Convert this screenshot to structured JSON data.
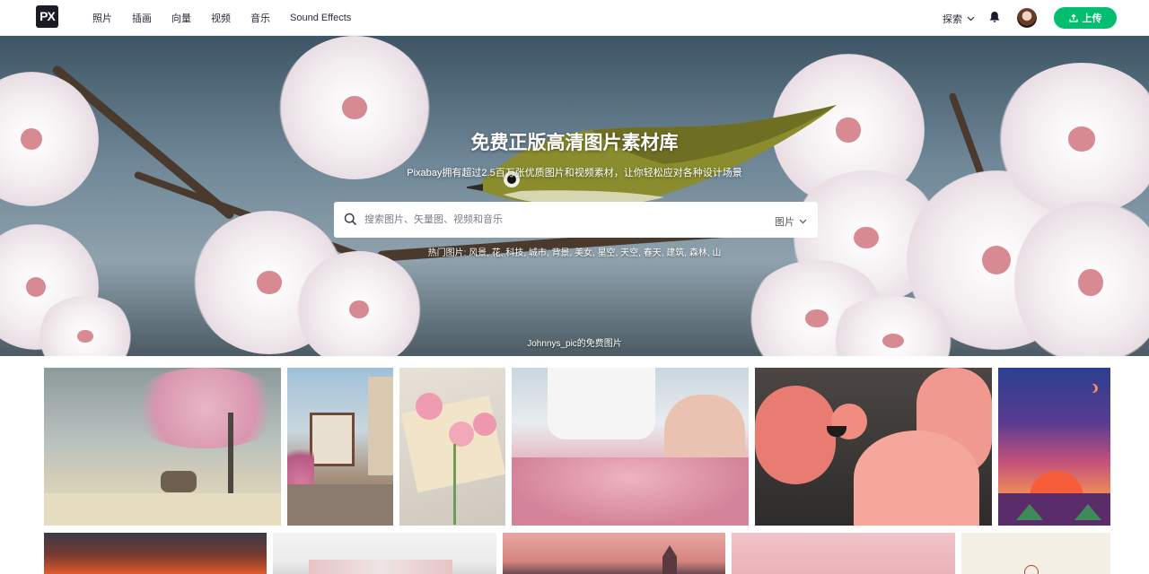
{
  "header": {
    "logo_text": "PX",
    "nav": [
      "照片",
      "插画",
      "向量",
      "视频",
      "音乐",
      "Sound Effects"
    ],
    "explore_label": "探索",
    "upload_label": "上传",
    "accent_color": "#02be6e"
  },
  "hero": {
    "title": "免费正版高清图片素材库",
    "subtitle": "Pixabay拥有超过2.5百万张优质图片和视频素材，让你轻松应对各种设计场景",
    "search": {
      "placeholder": "搜索图片、矢量图、视频和音乐",
      "type_label": "图片"
    },
    "popular_label": "热门图片:",
    "popular_tags": [
      "风景",
      "花",
      "科技",
      "城市",
      "背景",
      "美女",
      "星空",
      "天空",
      "春天",
      "建筑",
      "森林",
      "山"
    ],
    "credit": "Johnnys_pic的免费图片"
  },
  "gallery": {
    "row1": [
      {
        "name": "deer-cherry-blossom"
      },
      {
        "name": "half-timbered-houses"
      },
      {
        "name": "carnations-postcard"
      },
      {
        "name": "sewing-machine-fabric"
      },
      {
        "name": "flamingos"
      },
      {
        "name": "sunset-illustration"
      }
    ],
    "row2": [
      {
        "name": "red-mountain-sunset"
      },
      {
        "name": "snowy-mountains"
      },
      {
        "name": "pink-sky-town"
      },
      {
        "name": "pink-flamingo-blur"
      },
      {
        "name": "minimal-illustration"
      }
    ]
  }
}
